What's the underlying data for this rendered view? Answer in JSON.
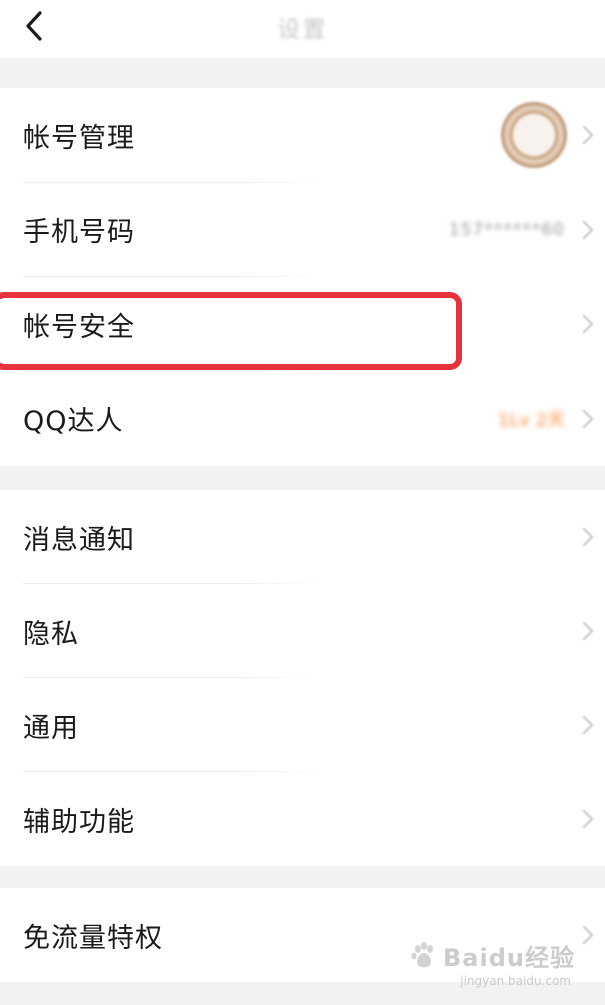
{
  "header": {
    "back_icon": "chevron-left-icon",
    "title": "设置"
  },
  "section_account": {
    "rows": [
      {
        "label": "帐号管理",
        "value_type": "avatar"
      },
      {
        "label": "手机号码",
        "value": "157******60"
      },
      {
        "label": "帐号安全",
        "highlighted": true
      },
      {
        "label": "QQ达人",
        "value": "1Lv 2天"
      }
    ]
  },
  "section_general": {
    "rows": [
      {
        "label": "消息通知"
      },
      {
        "label": "隐私"
      },
      {
        "label": "通用"
      },
      {
        "label": "辅助功能"
      }
    ]
  },
  "section_extra": {
    "rows": [
      {
        "label": "免流量特权"
      }
    ]
  },
  "watermark": {
    "text": "Baidu经验",
    "sub": "jingyan.baidu.com"
  },
  "colors": {
    "highlight": "#e8333f",
    "accent_orange": "#ff8a3a",
    "background": "#f2f2f5"
  }
}
